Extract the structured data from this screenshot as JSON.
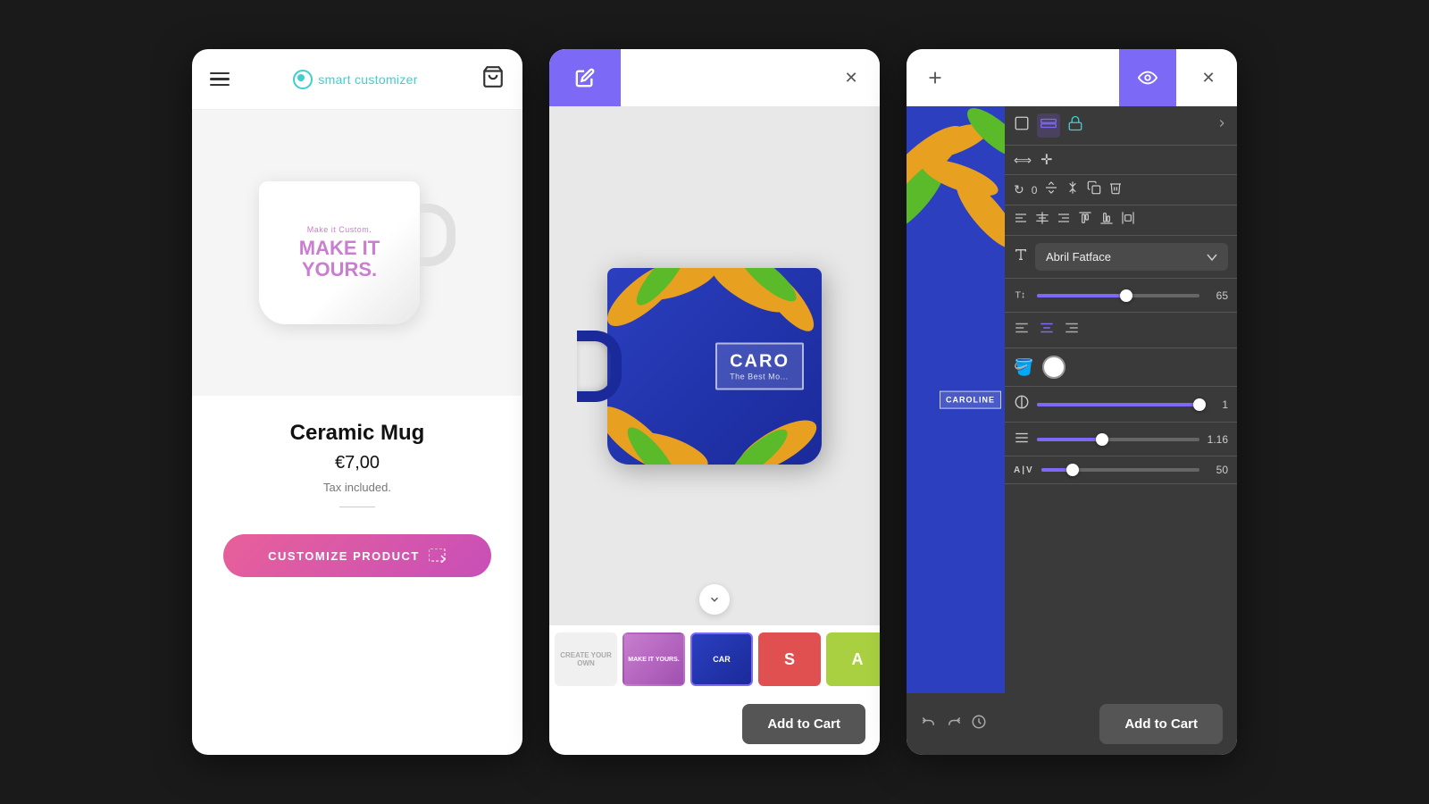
{
  "app": {
    "title": "Smart Customizer"
  },
  "card1": {
    "brand_name": "smart customizer",
    "product": {
      "name": "Ceramic Mug",
      "price": "€7,00",
      "tax": "Tax included.",
      "mug_text_small": "Make it Custom.",
      "mug_text_large": "MAKE IT\nYOURS."
    },
    "customize_btn_label": "CUSTOMIZE PRODUCT"
  },
  "card2": {
    "pencil_icon": "✏",
    "close_icon": "✕",
    "chevron_icon": "⌄",
    "mug_name": "CARO",
    "mug_subtitle": "The Best Mo...",
    "thumbnails": [
      {
        "id": "t1",
        "bg": "#f5f5f5",
        "text": "CREAT YOUR OWN",
        "text_color": "#aaa",
        "active": false
      },
      {
        "id": "t2",
        "bg": "#c97ecf",
        "text": "MAKE IT YOURS.",
        "text_color": "#fff",
        "active": false
      },
      {
        "id": "t3",
        "bg": "#2b3fbf",
        "text": "CAR",
        "text_color": "#fff",
        "active": true
      },
      {
        "id": "t4",
        "bg": "#e05050",
        "text": "S",
        "text_color": "#fff",
        "active": false
      },
      {
        "id": "t5",
        "bg": "#a8d040",
        "text": "A",
        "text_color": "#fff",
        "active": false
      }
    ],
    "add_to_cart_label": "Add to Cart"
  },
  "card3": {
    "add_icon": "+",
    "eye_icon": "👁",
    "close_icon": "✕",
    "mug_preview_text": "CAROLINE",
    "font_name": "Abril Fatface",
    "font_size_value": "65",
    "opacity_value": "1",
    "line_height_value": "1.16",
    "letter_spacing_value": "50",
    "toolbar": {
      "undo_label": "↩",
      "redo_label": "↪",
      "history_label": "🕐"
    },
    "add_to_cart_label": "Add to Cart"
  }
}
